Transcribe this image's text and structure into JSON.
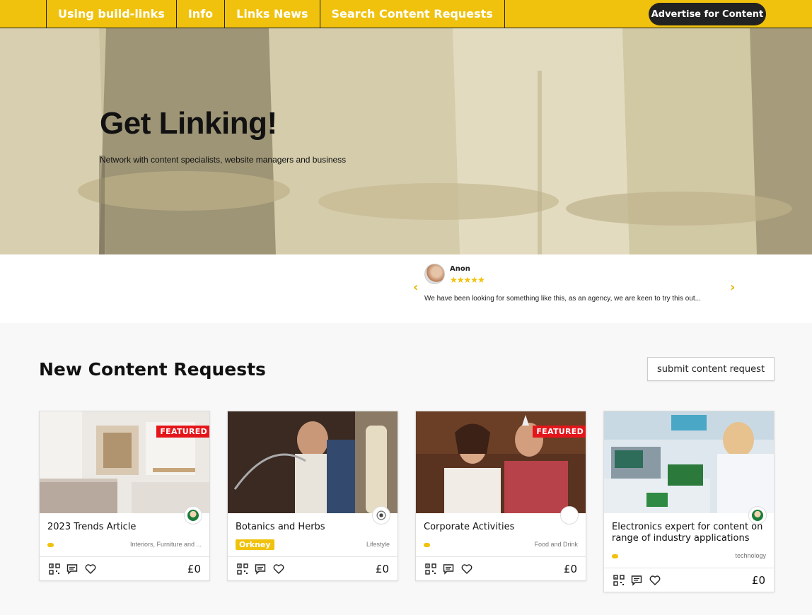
{
  "nav": {
    "items": [
      "Using build-links",
      "Info",
      "Links News",
      "Search Content Requests"
    ],
    "advertise_label": "Advertise for Content"
  },
  "hero": {
    "title": "Get Linking!",
    "subtitle": "Network with content specialists, website managers and business"
  },
  "testimonial": {
    "name": "Anon",
    "stars": "★★★★★",
    "text": "We have been looking for something like this, as an agency, we are keen to try this out...",
    "prev": "‹",
    "next": "›"
  },
  "section": {
    "title": "New Content Requests",
    "submit_label": "submit content request"
  },
  "cards": [
    {
      "title": "2023 Trends Article",
      "featured": "FEATURED",
      "category": "Interiors, Furniture and ...",
      "price": "£0",
      "tag": ""
    },
    {
      "title": "Botanics and Herbs",
      "featured": "",
      "category": "Lifestyle",
      "price": "£0",
      "tag": "Orkney"
    },
    {
      "title": "Corporate Activities",
      "featured": "FEATURED",
      "category": "Food and Drink",
      "price": "£0",
      "tag": ""
    },
    {
      "title": "Electronics expert for content on range of industry applications",
      "featured": "",
      "category": "technology",
      "price": "£0",
      "tag": ""
    }
  ],
  "colors": {
    "brand_yellow": "#f0c20d",
    "featured_red": "#e4161b",
    "dark": "#222222"
  },
  "icons": [
    "qr-code-icon",
    "message-icon",
    "heart-icon"
  ]
}
